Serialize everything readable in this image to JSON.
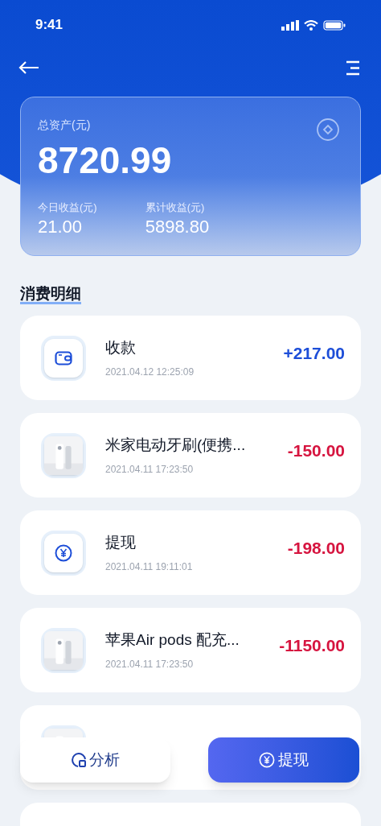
{
  "status_bar": {
    "time": "9:41"
  },
  "summary": {
    "label": "总资产(元)",
    "total": "8720.99",
    "stats": [
      {
        "label": "今日收益(元)",
        "value": "21.00"
      },
      {
        "label": "累计收益(元)",
        "value": "5898.80"
      }
    ]
  },
  "section_title": "消费明细",
  "transactions": [
    {
      "kind": "income",
      "title": "收款",
      "time": "2021.04.12 12:25:09",
      "amount": "+217.00"
    },
    {
      "kind": "purchase",
      "title": "米家电动牙刷(便携...",
      "time": "2021.04.11 17:23:50",
      "amount": "-150.00"
    },
    {
      "kind": "withdrawal",
      "title": "提现",
      "time": "2021.04.11 19:11:01",
      "amount": "-198.00"
    },
    {
      "kind": "purchase",
      "title": "苹果Air pods 配充...",
      "time": "2021.04.11 17:23:50",
      "amount": "-1150.00"
    }
  ],
  "hidden_cards": [
    {
      "kind": "purchase"
    },
    {
      "kind": "blank"
    }
  ],
  "actions": [
    {
      "label": "分析",
      "kind": "secondary"
    },
    {
      "label": "提现",
      "kind": "primary"
    }
  ]
}
